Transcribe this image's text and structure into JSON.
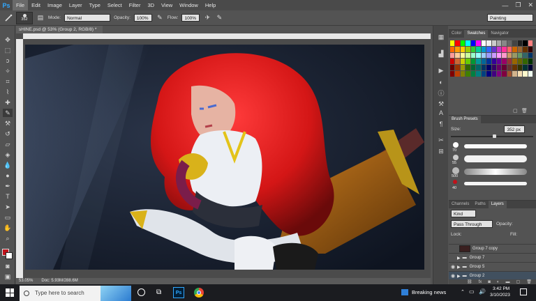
{
  "app": {
    "logo": "Ps"
  },
  "menu": [
    "File",
    "Edit",
    "Image",
    "Layer",
    "Type",
    "Select",
    "Filter",
    "3D",
    "View",
    "Window",
    "Help"
  ],
  "window_controls": [
    "—",
    "❐",
    "✕"
  ],
  "options_bar": {
    "brush_size": "352",
    "mode_label": "Mode:",
    "mode_value": "Normal",
    "opacity_label": "Opacity:",
    "opacity_value": "100%",
    "flow_label": "Flow:",
    "flow_value": "100%",
    "workspace": "Painting"
  },
  "document": {
    "tab_title": "sHINE.psd @ 53% (Group 2, RGB/8) *",
    "close_glyph": "×",
    "zoom": "53.05%",
    "doc_info": "Doc: 5.93M/288.6M"
  },
  "swatches_panel": {
    "tabs": [
      "Color",
      "Swatches",
      "Navigator"
    ],
    "active_tab": "Swatches",
    "colors": [
      "#ffff00",
      "#ff0000",
      "#00ff00",
      "#00ffff",
      "#0000ff",
      "#ff00ff",
      "#ffffff",
      "#eeeeee",
      "#cccccc",
      "#aaaaaa",
      "#888888",
      "#666666",
      "#444444",
      "#222222",
      "#000000",
      "#ff8080",
      "#ff6600",
      "#ff9900",
      "#ffcc00",
      "#99cc00",
      "#33cc33",
      "#00cc99",
      "#0099cc",
      "#3366ff",
      "#6633cc",
      "#cc33cc",
      "#ff3399",
      "#ff6666",
      "#cc6600",
      "#996633",
      "#663300",
      "#330000",
      "#ff9999",
      "#ffcc99",
      "#ffff99",
      "#ccff99",
      "#99ffcc",
      "#99ffff",
      "#99ccff",
      "#9999ff",
      "#cc99ff",
      "#ff99ff",
      "#ff99cc",
      "#cc9966",
      "#999966",
      "#669966",
      "#336666",
      "#003366",
      "#cc0000",
      "#cc6633",
      "#cccc00",
      "#66cc00",
      "#009933",
      "#009999",
      "#006699",
      "#003399",
      "#330099",
      "#660099",
      "#990066",
      "#993333",
      "#996600",
      "#666600",
      "#336600",
      "#003300",
      "#660000",
      "#993300",
      "#999900",
      "#336600",
      "#006633",
      "#006666",
      "#003366",
      "#000066",
      "#330066",
      "#660066",
      "#660033",
      "#663333",
      "#663300",
      "#333300",
      "#003333",
      "#000033",
      "#800000",
      "#c04000",
      "#808000",
      "#408000",
      "#008040",
      "#008080",
      "#004080",
      "#000080",
      "#400080",
      "#800080",
      "#800040",
      "#a0522d",
      "#d2b48c",
      "#f5deb3",
      "#fffacd",
      "#f0fff0"
    ]
  },
  "brush_presets": {
    "title": "Brush Presets",
    "size_label": "Size:",
    "size_value": "352 px",
    "presets": [
      "70",
      "55",
      "500",
      "40"
    ]
  },
  "layers_panel": {
    "tabs": [
      "Channels",
      "Paths",
      "Layers"
    ],
    "active_tab": "Layers",
    "filter": "Kind",
    "blend": "Pass Through",
    "opacity_label": "Opacity:",
    "lock_label": "Lock:",
    "fill_label": "Fill:",
    "layers": [
      "Group 7 copy",
      "Group 7",
      "Group 5",
      "Group 2"
    ]
  },
  "taskbar": {
    "search_placeholder": "Type here to search",
    "news": "Breaking news",
    "time": "3:42 PM",
    "date": "3/10/2023"
  }
}
